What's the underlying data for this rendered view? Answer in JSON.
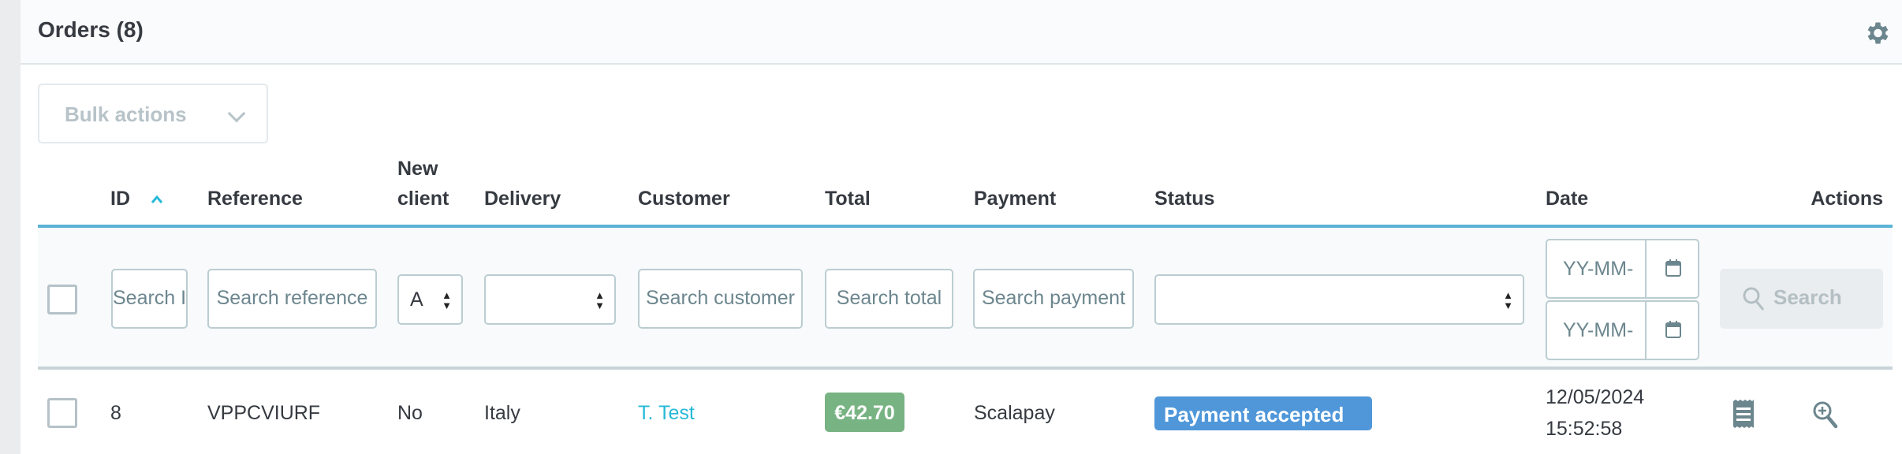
{
  "panel": {
    "title": "Orders (8)",
    "settings_icon": "gear-icon"
  },
  "bulk_actions": {
    "label": "Bulk actions"
  },
  "columns": {
    "id": "ID",
    "reference": "Reference",
    "new_client_1": "New",
    "new_client_2": "client",
    "delivery": "Delivery",
    "customer": "Customer",
    "total": "Total",
    "payment": "Payment",
    "status": "Status",
    "date": "Date",
    "actions": "Actions"
  },
  "sort": {
    "column": "ID",
    "direction": "ascending"
  },
  "filters": {
    "id_placeholder": "Search ID",
    "reference_placeholder": "Search reference",
    "new_client_value": "A",
    "delivery_value": "",
    "customer_placeholder": "Search customer",
    "total_placeholder": "Search total",
    "payment_placeholder": "Search payment",
    "status_value": "",
    "date_from_placeholder": "YY-MM-DD",
    "date_to_placeholder": "YY-MM-DD",
    "search_button": "Search"
  },
  "rows": [
    {
      "id": "8",
      "reference": "VPPCVIURF",
      "new_client": "No",
      "delivery": "Italy",
      "customer": "T. Test",
      "total": "€42.70",
      "payment": "Scalapay",
      "status": "Payment accepted",
      "date": "12/05/2024",
      "time": "15:52:58"
    }
  ],
  "colors": {
    "accent": "#25b9d7",
    "total_badge": "#78b383",
    "status_badge": "#4f97d9"
  }
}
